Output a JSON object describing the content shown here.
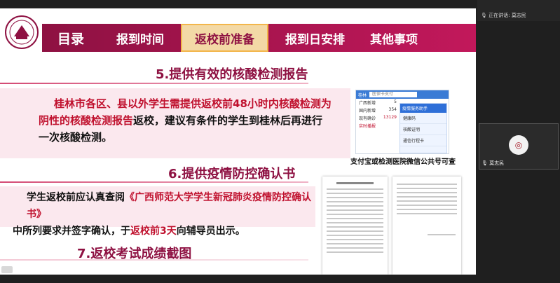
{
  "meeting": {
    "speaking_label": "正在讲话: 莫志民",
    "participant_name": "莫志民"
  },
  "nav": {
    "items": [
      "目录",
      "报到时间",
      "返校前准备",
      "报到日安排",
      "其他事项"
    ]
  },
  "section5": {
    "title": "5.提供有效的核酸检测报告",
    "para_red1": "桂林市各区、县以外学生需提供返校前48小时内核酸检测为",
    "para_red2": "阴性的核酸检测报告",
    "para_tail2": "返校，建议有条件的学生到桂林后再进行",
    "para_line3": "一次核酸检测。",
    "caption": "支付宝或检测医院微信公共号可查",
    "phone": {
      "city": "桂林",
      "search": "医保卡支付",
      "rows": [
        [
          "广西新增",
          "5"
        ],
        [
          "国内新增",
          "354"
        ],
        [
          "现有确诊",
          "13129"
        ]
      ],
      "realtime": "实时播报",
      "panel_title": "疫情服务助手",
      "panel_items": [
        "健康码",
        "核酸证明",
        "通信行程卡"
      ]
    }
  },
  "section6": {
    "title": "6.提供疫情防控确认书",
    "p1a": "学生返校前应认真查阅",
    "p1b": "《广西师范大学学生新冠肺炎疫情防控确认书》",
    "p2a": "中所列要求并签字确认，于",
    "p2b": "返校前3天",
    "p2c": "向辅导员出示。"
  },
  "section7": {
    "title": "7.返校考试成绩截图"
  }
}
